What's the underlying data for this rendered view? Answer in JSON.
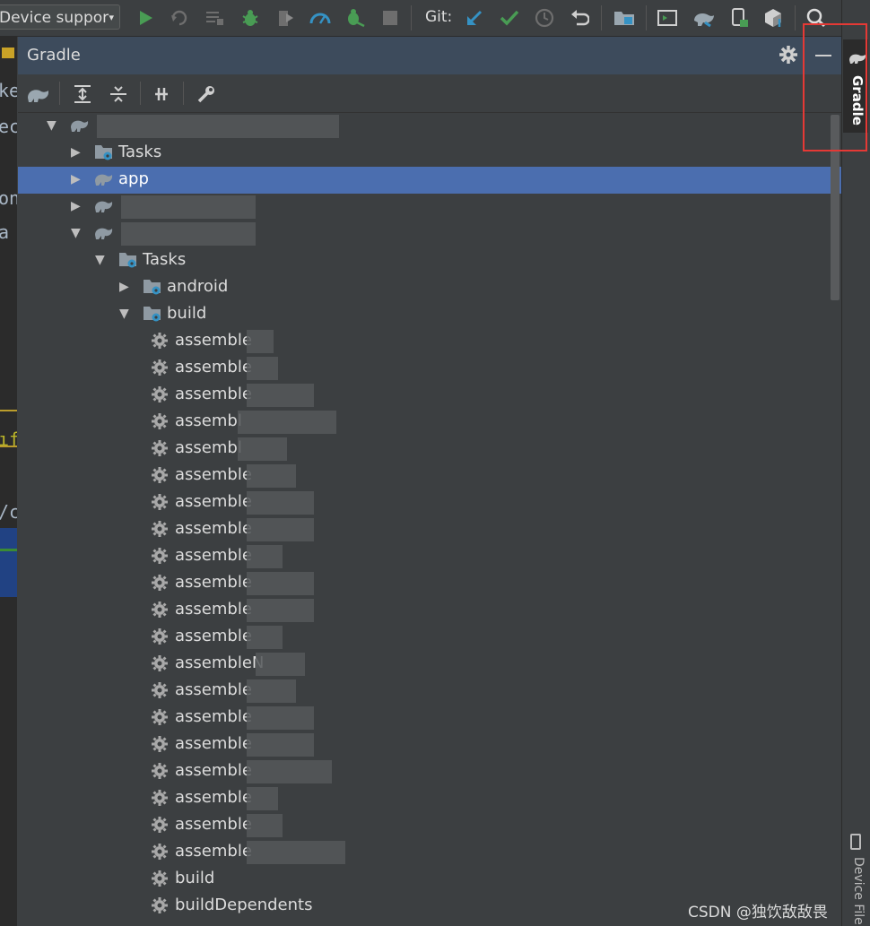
{
  "toolbar": {
    "device_combo": "Device suppor",
    "git_label": "Git:",
    "icons": [
      "run-icon",
      "rerun-icon",
      "build-list-icon",
      "debug-icon",
      "coverage-icon",
      "profile-icon",
      "attach-debugger-icon",
      "stop-icon",
      "git-update-icon",
      "git-commit-icon",
      "git-history-icon",
      "git-rollback-icon",
      "project-structure-icon",
      "terminal-icon",
      "gradle-sync-icon",
      "avd-manager-icon",
      "sdk-manager-icon",
      "search-icon",
      "avatar"
    ]
  },
  "left_strip": {
    "fragments": [
      "ke",
      "ec",
      "on",
      "a",
      "ıf",
      "/c"
    ]
  },
  "gradle_panel": {
    "title": "Gradle",
    "toolbar_icons": [
      "gradle-refresh-icon",
      "expand-all-icon",
      "collapse-all-icon",
      "toggle-offline-icon",
      "gradle-settings-icon"
    ]
  },
  "tree": [
    {
      "label": "",
      "icon": "gradle-elephant",
      "arrow": "expanded",
      "indent": 0,
      "redacted": true
    },
    {
      "label": "Tasks",
      "icon": "tasks-folder",
      "arrow": "collapsed",
      "indent": 1
    },
    {
      "label": "app",
      "icon": "gradle-elephant",
      "arrow": "collapsed",
      "indent": 1,
      "selected": true
    },
    {
      "label": "",
      "icon": "gradle-elephant",
      "arrow": "collapsed",
      "indent": 1,
      "redacted": true
    },
    {
      "label": "",
      "icon": "gradle-elephant",
      "arrow": "expanded",
      "indent": 1,
      "redacted": true
    },
    {
      "label": "Tasks",
      "icon": "tasks-folder",
      "arrow": "expanded",
      "indent": 2
    },
    {
      "label": "android",
      "icon": "tasks-folder",
      "arrow": "collapsed",
      "indent": 3
    },
    {
      "label": "build",
      "icon": "tasks-folder",
      "arrow": "expanded",
      "indent": 3
    },
    {
      "label": "assemble",
      "icon": "gear",
      "indent": 4,
      "redacted": true
    },
    {
      "label": "assemble",
      "icon": "gear",
      "indent": 4,
      "redacted": true
    },
    {
      "label": "assemble",
      "icon": "gear",
      "indent": 4,
      "redacted": true
    },
    {
      "label": "assembl",
      "icon": "gear",
      "indent": 4,
      "redacted": true
    },
    {
      "label": "assembl",
      "icon": "gear",
      "indent": 4,
      "redacted": true
    },
    {
      "label": "assemble",
      "icon": "gear",
      "indent": 4,
      "redacted": true
    },
    {
      "label": "assemble",
      "icon": "gear",
      "indent": 4,
      "redacted": true
    },
    {
      "label": "assemble",
      "icon": "gear",
      "indent": 4,
      "redacted": true
    },
    {
      "label": "assemble",
      "icon": "gear",
      "indent": 4,
      "redacted": true
    },
    {
      "label": "assemble",
      "icon": "gear",
      "indent": 4,
      "redacted": true
    },
    {
      "label": "assemble",
      "icon": "gear",
      "indent": 4,
      "redacted": true
    },
    {
      "label": "assemble",
      "icon": "gear",
      "indent": 4,
      "redacted": true
    },
    {
      "label": "assembleN",
      "icon": "gear",
      "indent": 4,
      "redacted": true
    },
    {
      "label": "assemble",
      "icon": "gear",
      "indent": 4,
      "redacted": true
    },
    {
      "label": "assemble",
      "icon": "gear",
      "indent": 4,
      "redacted": true
    },
    {
      "label": "assemble",
      "icon": "gear",
      "indent": 4,
      "redacted": true
    },
    {
      "label": "assemble",
      "icon": "gear",
      "indent": 4,
      "redacted": true
    },
    {
      "label": "assemble",
      "icon": "gear",
      "indent": 4,
      "redacted": true
    },
    {
      "label": "assemble",
      "icon": "gear",
      "indent": 4,
      "redacted": true
    },
    {
      "label": "assemble",
      "icon": "gear",
      "indent": 4,
      "redacted": true
    },
    {
      "label": "build",
      "icon": "gear",
      "indent": 4
    },
    {
      "label": "buildDependents",
      "icon": "gear",
      "indent": 4
    }
  ],
  "right_strip": {
    "gradle_tab": "Gradle",
    "device_tab": "Device File"
  },
  "watermark": "CSDN @独饮敌敌畏",
  "colors": {
    "selection": "#4b6eaf",
    "header": "#3d4b5c",
    "highlight_box": "#e53935"
  }
}
